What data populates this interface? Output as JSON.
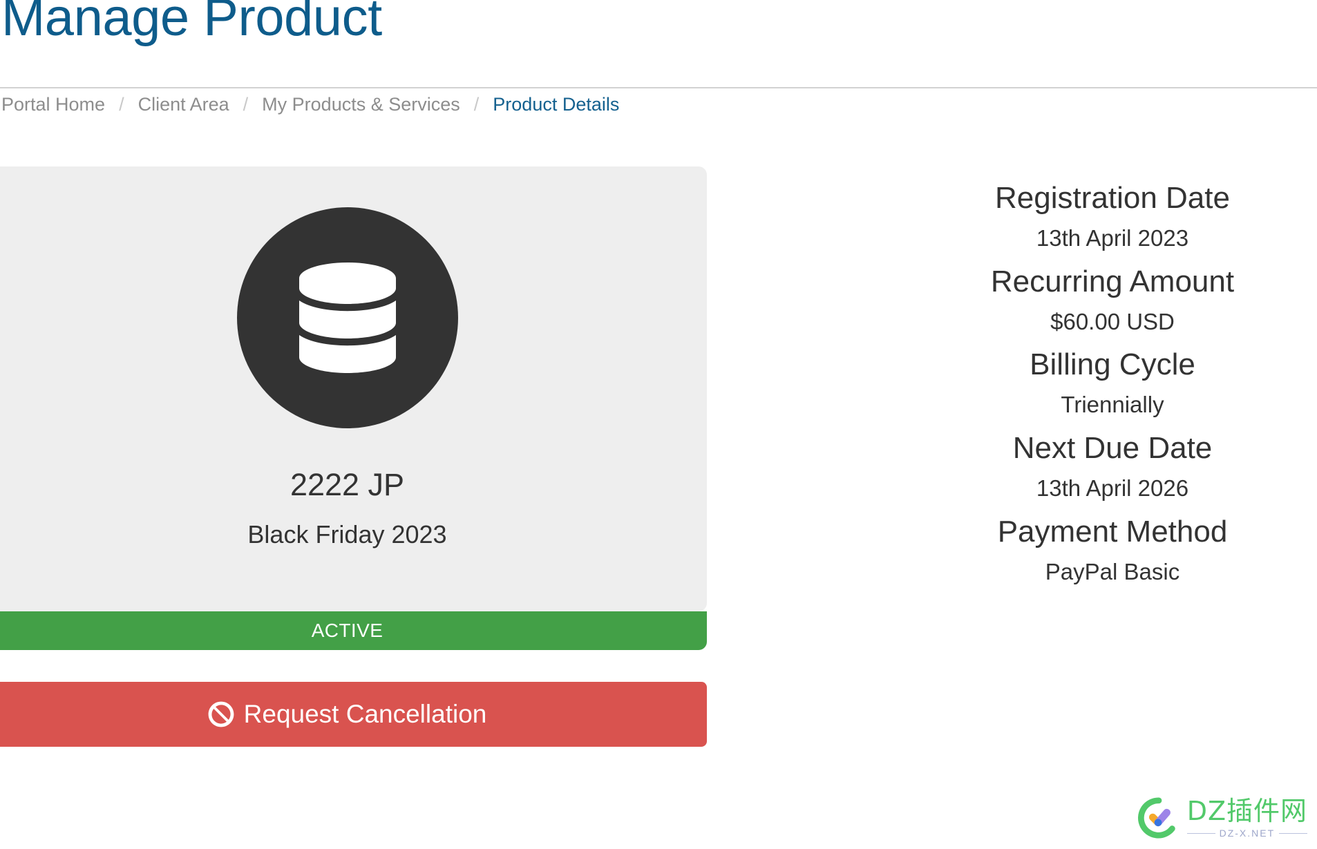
{
  "header": {
    "title": "Manage Product"
  },
  "breadcrumb": {
    "separator": "/",
    "items": [
      {
        "label": "Portal Home",
        "active": false
      },
      {
        "label": "Client Area",
        "active": false
      },
      {
        "label": "My Products & Services",
        "active": false
      },
      {
        "label": "Product Details",
        "active": true
      }
    ]
  },
  "product": {
    "icon": "database-icon",
    "name": "2222 JP",
    "subtitle": "Black Friday 2023",
    "status_label": "ACTIVE",
    "status_color": "#43a047",
    "cancel_button": {
      "label": "Request Cancellation",
      "icon": "ban-icon",
      "color": "#d9534f"
    }
  },
  "details": [
    {
      "label": "Registration Date",
      "value": "13th April 2023"
    },
    {
      "label": "Recurring Amount",
      "value": "$60.00 USD"
    },
    {
      "label": "Billing Cycle",
      "value": "Triennially"
    },
    {
      "label": "Next Due Date",
      "value": "13th April 2026"
    },
    {
      "label": "Payment Method",
      "value": "PayPal Basic"
    }
  ],
  "watermark": {
    "title": "DZ插件网",
    "subtitle": "DZ-X.NET",
    "color": "#4cc764"
  },
  "colors": {
    "title_blue": "#0e5c8b",
    "link_blue": "#15618f",
    "muted_text": "#8d8d8d",
    "card_bg": "#eeeeee",
    "icon_circle": "#333333",
    "status_green": "#43a047",
    "danger_red": "#d9534f"
  }
}
